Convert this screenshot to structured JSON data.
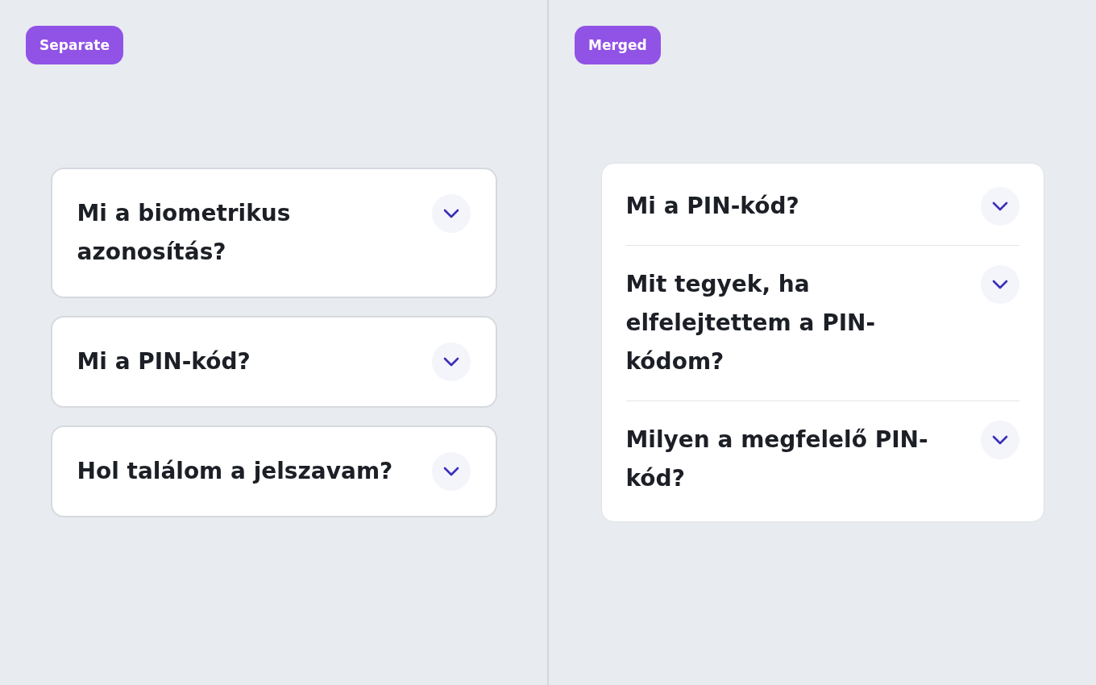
{
  "panels": [
    {
      "label": "Separate",
      "kind": "separate",
      "items": [
        {
          "question": "Mi a biometrikus azonosítás?",
          "expanded": false
        },
        {
          "question": "Mi a PIN-kód?",
          "expanded": false
        },
        {
          "question": "Hol találom a jelszavam?",
          "expanded": false
        }
      ]
    },
    {
      "label": "Merged",
      "kind": "merged",
      "items": [
        {
          "question": "Mi a PIN-kód?",
          "expanded": false
        },
        {
          "question": "Mit tegyek, ha elfelejtettem a PIN-kódom?",
          "expanded": false
        },
        {
          "question": "Milyen a megfelelő PIN-kód?",
          "expanded": false
        }
      ]
    }
  ]
}
